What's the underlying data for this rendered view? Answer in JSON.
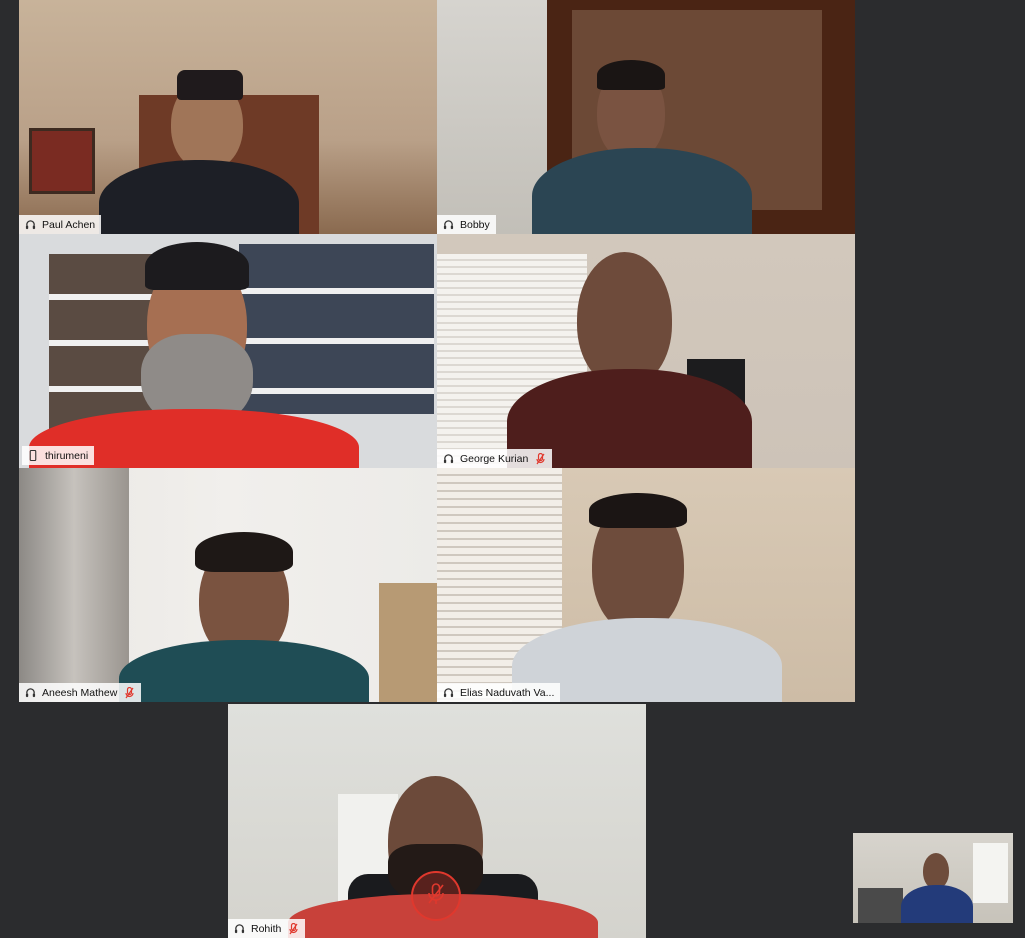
{
  "participants": [
    {
      "name": "Paul Achen",
      "audio": "headphone",
      "muted": false
    },
    {
      "name": "Bobby",
      "audio": "headphone",
      "muted": false
    },
    {
      "name": "thirumeni",
      "audio": "phone",
      "muted": false,
      "active_speaker": true
    },
    {
      "name": "George Kurian",
      "audio": "headphone",
      "muted": true
    },
    {
      "name": "Aneesh Mathew",
      "audio": "headphone",
      "muted": true
    },
    {
      "name": "Elias Naduvath Va...",
      "audio": "headphone",
      "muted": false
    },
    {
      "name": "Rohith",
      "audio": "headphone",
      "muted": true
    }
  ],
  "colors": {
    "background": "#2b2c2e",
    "active_border": "#23a6d5",
    "mute_red": "#e0382d"
  },
  "icons": {
    "headphone": "headphone-icon",
    "phone": "phone-icon",
    "muted": "mic-muted-icon",
    "unmute_overlay": "mic-muted-icon"
  }
}
